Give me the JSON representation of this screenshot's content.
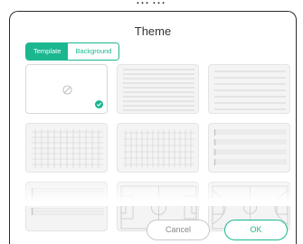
{
  "dialog": {
    "title": "Theme",
    "tabs": [
      {
        "label": "Template",
        "active": true
      },
      {
        "label": "Background",
        "active": false
      }
    ],
    "templates": [
      {
        "name": "None",
        "icon": "no-symbol-icon",
        "selected": true
      },
      {
        "name": "Lined narrow",
        "icon": "lined-icon",
        "selected": false
      },
      {
        "name": "Lined wide",
        "icon": "lined-icon",
        "selected": false
      },
      {
        "name": "Grid",
        "icon": "grid-icon",
        "selected": false
      },
      {
        "name": "Grid fine",
        "icon": "grid-icon",
        "selected": false
      },
      {
        "name": "Music staff",
        "icon": "staff-icon",
        "selected": false
      },
      {
        "name": "Music staff alt",
        "icon": "staff-icon",
        "selected": false
      },
      {
        "name": "Soccer field",
        "icon": "soccer-field-icon",
        "selected": false
      },
      {
        "name": "Basketball court",
        "icon": "basketball-court-icon",
        "selected": false
      }
    ],
    "cancel_label": "Cancel",
    "ok_label": "OK"
  },
  "colors": {
    "accent": "#1bb78f"
  }
}
